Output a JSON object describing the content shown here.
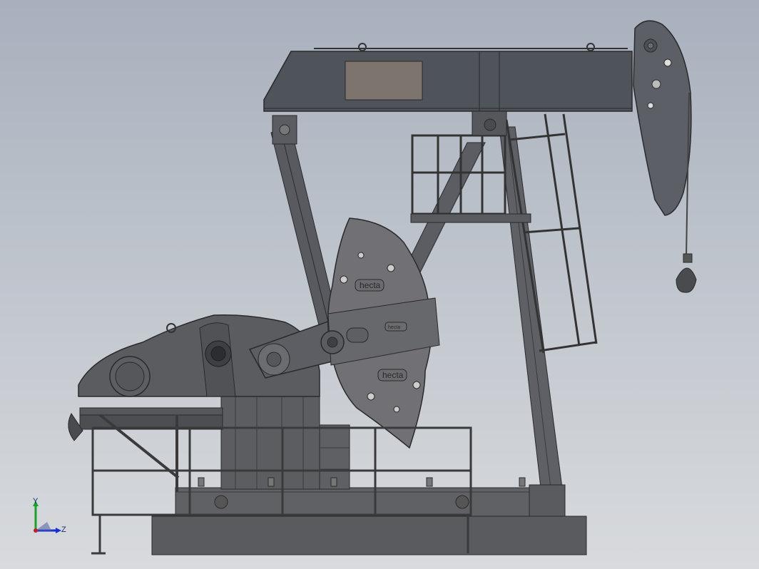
{
  "viewport": {
    "background_top": "#a8b0bd",
    "background_bottom": "#d8dadd"
  },
  "model": {
    "body_color": "#5d5f63",
    "body_dark": "#3d3f44",
    "beam_color": "#4e5259",
    "plate_color": "#7b736c",
    "crank_color": "#6a6a6c",
    "base_color": "#58595c",
    "rail_color": "#3a3a3c",
    "crank_text_top": "hecta",
    "crank_text_bottom": "hecta",
    "crank_text_mid": "hecta"
  },
  "triad": {
    "y_label": "Y",
    "z_label": "Z",
    "y_color": "#1fa02a",
    "z_color": "#1a2fd0",
    "origin_color": "#c0202a"
  }
}
